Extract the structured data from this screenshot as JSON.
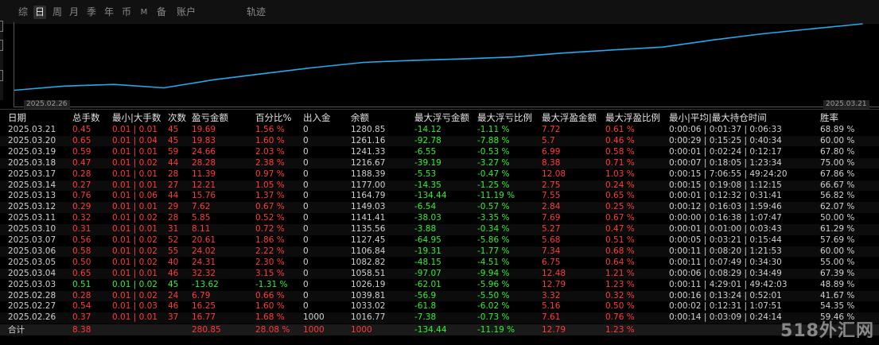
{
  "tabs": [
    {
      "label": "综",
      "active": false
    },
    {
      "label": "日",
      "active": true
    },
    {
      "label": "周",
      "active": false
    },
    {
      "label": "月",
      "active": false
    },
    {
      "label": "季",
      "active": false
    },
    {
      "label": "年",
      "active": false
    },
    {
      "label": "币",
      "active": false
    },
    {
      "label": "M",
      "active": false
    },
    {
      "label": "备",
      "active": false
    },
    {
      "label": "账户",
      "active": false
    },
    {
      "label": "轨迹",
      "active": false
    }
  ],
  "colors": {
    "line": "#22aaee",
    "positive": "#33ee33",
    "negative": "#ff3a3a"
  },
  "chart_data": {
    "type": "line",
    "x": [
      "2025.02.26",
      "2025.02.27",
      "2025.02.28",
      "2025.03.03",
      "2025.03.04",
      "2025.03.05",
      "2025.03.06",
      "2025.03.07",
      "2025.03.10",
      "2025.03.11",
      "2025.03.12",
      "2025.03.13",
      "2025.03.14",
      "2025.03.17",
      "2025.03.18",
      "2025.03.19",
      "2025.03.20",
      "2025.03.21"
    ],
    "series": [
      {
        "values": [
          1016.77,
          1033.02,
          1039.81,
          1026.19,
          1058.51,
          1082.82,
          1106.84,
          1127.45,
          1135.56,
          1141.41,
          1149.03,
          1164.79,
          1177.0,
          1188.39,
          1216.67,
          1241.33,
          1261.16,
          1280.85
        ]
      }
    ],
    "x_start_label": "2025.02.26",
    "x_end_label": "2025.03.21",
    "grid": false
  },
  "table": {
    "headers": [
      "日期",
      "总手数",
      "最小|大手数",
      "次数",
      "盈亏金额",
      "百分比%",
      "出入金",
      "余额",
      "最大浮亏金额",
      "最大浮亏比例",
      "最大浮盈金额",
      "最大浮盈比例",
      "最小|平均|最大持仓时间",
      "胜率"
    ],
    "rows": [
      [
        "2025.03.21",
        "0.45",
        "0.01 | 0.01",
        "45",
        "19.69",
        "1.56 %",
        "0",
        "1280.85",
        "-14.12",
        "-1.11 %",
        "7.72",
        "0.61 %",
        "0:00:06 | 0:01:37 | 0:06:33",
        "68.89 %"
      ],
      [
        "2025.03.20",
        "0.65",
        "0.01 | 0.04",
        "45",
        "19.83",
        "1.60 %",
        "0",
        "1261.16",
        "-92.78",
        "-7.88 %",
        "5.7",
        "0.46 %",
        "0:00:29 | 0:15:25 | 0:40:34",
        "60.00 %"
      ],
      [
        "2025.03.19",
        "0.59",
        "0.01 | 0.01",
        "59",
        "24.66",
        "2.03 %",
        "0",
        "1241.33",
        "-6.55",
        "-0.53 %",
        "6.99",
        "0.58 %",
        "0:00:01 | 0:02:24 | 0:12:17",
        "67.80 %"
      ],
      [
        "2025.03.18",
        "0.47",
        "0.01 | 0.02",
        "44",
        "28.28",
        "2.38 %",
        "0",
        "1216.67",
        "-39.19",
        "-3.27 %",
        "8.38",
        "0.71 %",
        "0:00:07 | 0:18:05 | 1:23:34",
        "75.00 %"
      ],
      [
        "2025.03.17",
        "0.28",
        "0.01 | 0.01",
        "28",
        "11.39",
        "0.97 %",
        "0",
        "1188.39",
        "-5.53",
        "-0.47 %",
        "12.08",
        "1.03 %",
        "0:00:15 | 7:06:55 | 49:24:20",
        "67.86 %"
      ],
      [
        "2025.03.14",
        "0.27",
        "0.01 | 0.01",
        "27",
        "12.21",
        "1.05 %",
        "0",
        "1177.00",
        "-14.35",
        "-1.25 %",
        "2.75",
        "0.24 %",
        "0:00:15 | 0:19:08 | 1:12:15",
        "66.67 %"
      ],
      [
        "2025.03.13",
        "0.76",
        "0.01 | 0.06",
        "44",
        "15.76",
        "1.37 %",
        "0",
        "1164.79",
        "-134.44",
        "-11.19 %",
        "7.55",
        "0.65 %",
        "0:00:01 | 0:12:32 | 0:31:41",
        "56.82 %"
      ],
      [
        "2025.03.12",
        "0.29",
        "0.01 | 0.01",
        "29",
        "7.62",
        "0.67 %",
        "0",
        "1149.03",
        "-6.54",
        "-0.57 %",
        "2.84",
        "0.25 %",
        "0:00:12 | 0:16:03 | 1:59:46",
        "62.07 %"
      ],
      [
        "2025.03.11",
        "0.32",
        "0.01 | 0.02",
        "28",
        "5.85",
        "0.52 %",
        "0",
        "1141.41",
        "-38.03",
        "-3.35 %",
        "7.69",
        "0.67 %",
        "0:00:00 | 0:16:38 | 1:07:47",
        "50.00 %"
      ],
      [
        "2025.03.10",
        "0.31",
        "0.01 | 0.01",
        "31",
        "8.11",
        "0.72 %",
        "0",
        "1135.56",
        "-3.88",
        "-0.34 %",
        "5.27",
        "0.47 %",
        "0:00:01 | 0:01:00 | 0:03:43",
        "61.29 %"
      ],
      [
        "2025.03.07",
        "0.56",
        "0.01 | 0.02",
        "52",
        "20.61",
        "1.86 %",
        "0",
        "1127.45",
        "-64.95",
        "-5.86 %",
        "5.68",
        "0.51 %",
        "0:00:05 | 0:03:21 | 0:15:44",
        "57.69 %"
      ],
      [
        "2025.03.06",
        "0.58",
        "0.01 | 0.02",
        "55",
        "24.02",
        "2.22 %",
        "0",
        "1106.84",
        "-19.31",
        "-1.77 %",
        "7.34",
        "0.68 %",
        "0:00:11 | 0:08:20 | 1:21:53",
        "60.00 %"
      ],
      [
        "2025.03.05",
        "0.50",
        "0.01 | 0.02",
        "40",
        "24.31",
        "2.30 %",
        "0",
        "1082.82",
        "-48.15",
        "-4.51 %",
        "6.75",
        "0.64 %",
        "0:00:11 | 0:07:49 | 0:34:30",
        "55.00 %"
      ],
      [
        "2025.03.04",
        "0.65",
        "0.01 | 0.01",
        "46",
        "32.32",
        "3.15 %",
        "0",
        "1058.51",
        "-97.07",
        "-9.94 %",
        "12.48",
        "1.21 %",
        "0:00:06 | 0:08:29 | 0:34:49",
        "67.39 %"
      ],
      [
        "2025.03.03",
        "0.51",
        "0.01 | 0.02",
        "45",
        "-13.62",
        "-1.31 %",
        "0",
        "1026.19",
        "-62.01",
        "-5.96 %",
        "12.79",
        "1.23 %",
        "0:00:11 | 4:29:01 | 49:42:03",
        "48.89 %"
      ],
      [
        "2025.02.28",
        "0.28",
        "0.01 | 0.02",
        "24",
        "6.79",
        "0.66 %",
        "0",
        "1039.81",
        "-56.9",
        "-5.50 %",
        "3.32",
        "0.32 %",
        "0:00:16 | 0:13:24 | 0:52:01",
        "41.67 %"
      ],
      [
        "2025.02.27",
        "0.54",
        "0.01 | 0.03",
        "46",
        "16.25",
        "1.60 %",
        "0",
        "1033.02",
        "-61.8",
        "-6.02 %",
        "5.16",
        "0.50 %",
        "0:00:02 | 0:12:31 | 1:07:51",
        "54.35 %"
      ],
      [
        "2025.02.26",
        "0.37",
        "0.01 | 0.01",
        "37",
        "16.77",
        "1.68 %",
        "1000",
        "1016.77",
        "-7.38",
        "-0.73 %",
        "7.61",
        "0.76 %",
        "0:00:14 | 0:03:09 | 0:24:14",
        "59.46 %"
      ]
    ],
    "total": {
      "label": "合计",
      "lots": "8.38",
      "pnl": "280.85",
      "pct": "28.08 %",
      "deposit": "1000",
      "balance": "1000",
      "max_dd": "-134.44",
      "max_dd_pct": "-11.19 %",
      "max_fp": "12.79",
      "max_fp_pct": "1.23 %"
    }
  },
  "watermark": "518外汇网"
}
